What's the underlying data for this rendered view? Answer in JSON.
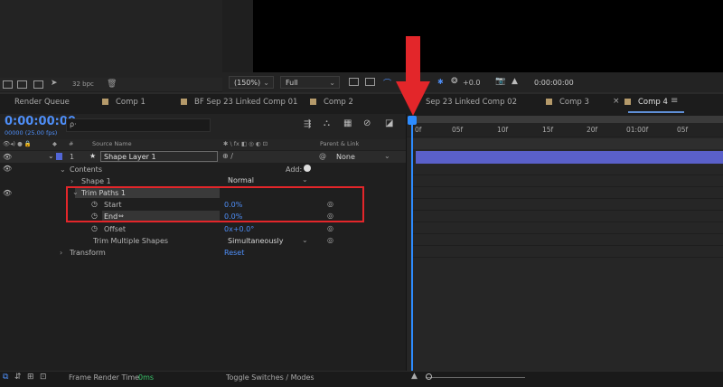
{
  "project": {
    "bpc": "32 bpc"
  },
  "viewer": {
    "zoom": "(150%)",
    "resolution": "Full",
    "exposure": "+0.0",
    "timecode": "0:00:00:00"
  },
  "tabs": [
    {
      "label": "Render Queue"
    },
    {
      "label": "Comp 1"
    },
    {
      "label": "BF Sep 23 Linked Comp 01"
    },
    {
      "label": "Comp 2"
    },
    {
      "label": "Sep 23 Linked Comp 02"
    },
    {
      "label": "Comp 3"
    },
    {
      "label": "Comp 4"
    }
  ],
  "timeline": {
    "timecode": "0:00:00:00",
    "fps": "00000 (25.00 fps)",
    "search_placeholder": "ρ·",
    "columns": {
      "source_name": "Source Name",
      "parent_link": "Parent & Link",
      "hash": "#"
    },
    "ruler": [
      "0f",
      "05f",
      "10f",
      "15f",
      "20f",
      "01:00f",
      "05f"
    ],
    "layer": {
      "number": "1",
      "name": "Shape Layer 1",
      "mode": "Normal",
      "parent": "None"
    },
    "rows": {
      "contents": "Contents",
      "add": "Add:",
      "shape1": "Shape 1",
      "shape1_mode": "Normal",
      "trim": "Trim Paths 1",
      "start": "Start",
      "start_val": "0.0%",
      "end": "End",
      "end_val": "0.0%",
      "offset": "Offset",
      "offset_val": "0x+0.0°",
      "multi": "Trim Multiple Shapes",
      "multi_val": "Simultaneously",
      "transform": "Transform",
      "reset": "Reset"
    }
  },
  "statusbar": {
    "frame_render_label": "Frame Render Time",
    "frame_render_value": "0ms",
    "toggle": "Toggle Switches / Modes"
  },
  "colors": {
    "accent": "#4e8ef7",
    "highlight": "#e3262a",
    "layer_bar": "#5a60c9"
  }
}
